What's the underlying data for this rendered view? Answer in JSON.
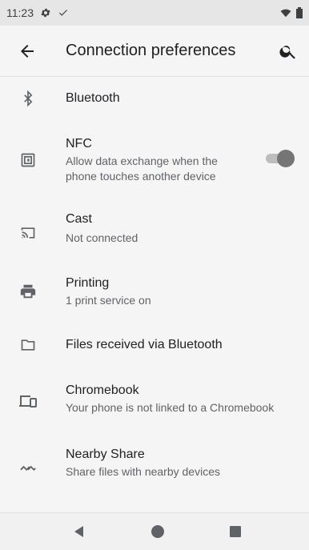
{
  "status_bar": {
    "time": "11:23",
    "icons": [
      "gear-icon",
      "check-icon",
      "wifi-icon",
      "battery-icon"
    ]
  },
  "app_bar": {
    "title": "Connection preferences",
    "back_icon": "arrow-back-icon",
    "search_icon": "search-icon"
  },
  "items": [
    {
      "icon": "bluetooth-icon",
      "title": "Bluetooth",
      "subtitle": ""
    },
    {
      "icon": "nfc-icon",
      "title": "NFC",
      "subtitle_line1": "Allow data exchange when the",
      "subtitle_line2": "phone touches another device",
      "toggle": "on"
    },
    {
      "icon": "cast-icon",
      "title": "Cast",
      "subtitle": "Not connected"
    },
    {
      "icon": "printer-icon",
      "title": "Printing",
      "subtitle": "1 print service on"
    },
    {
      "icon": "folder-icon",
      "title": "Files received via Bluetooth",
      "subtitle": ""
    },
    {
      "icon": "chromebook-icon",
      "title": "Chromebook",
      "subtitle": "Your phone is not linked to a Chromebook"
    },
    {
      "icon": "nearby-share-icon",
      "title": "Nearby Share",
      "subtitle": "Share files with nearby devices"
    }
  ],
  "nav_bar": {
    "icons": [
      "back-triangle-icon",
      "home-circle-icon",
      "recents-square-icon"
    ]
  },
  "colors": {
    "background": "#f5f5f5",
    "text_primary": "#202124",
    "text_secondary": "#5f6368",
    "icon": "#5f6368",
    "toggle_thumb": "#757575",
    "toggle_track": "#bdbdbd"
  }
}
